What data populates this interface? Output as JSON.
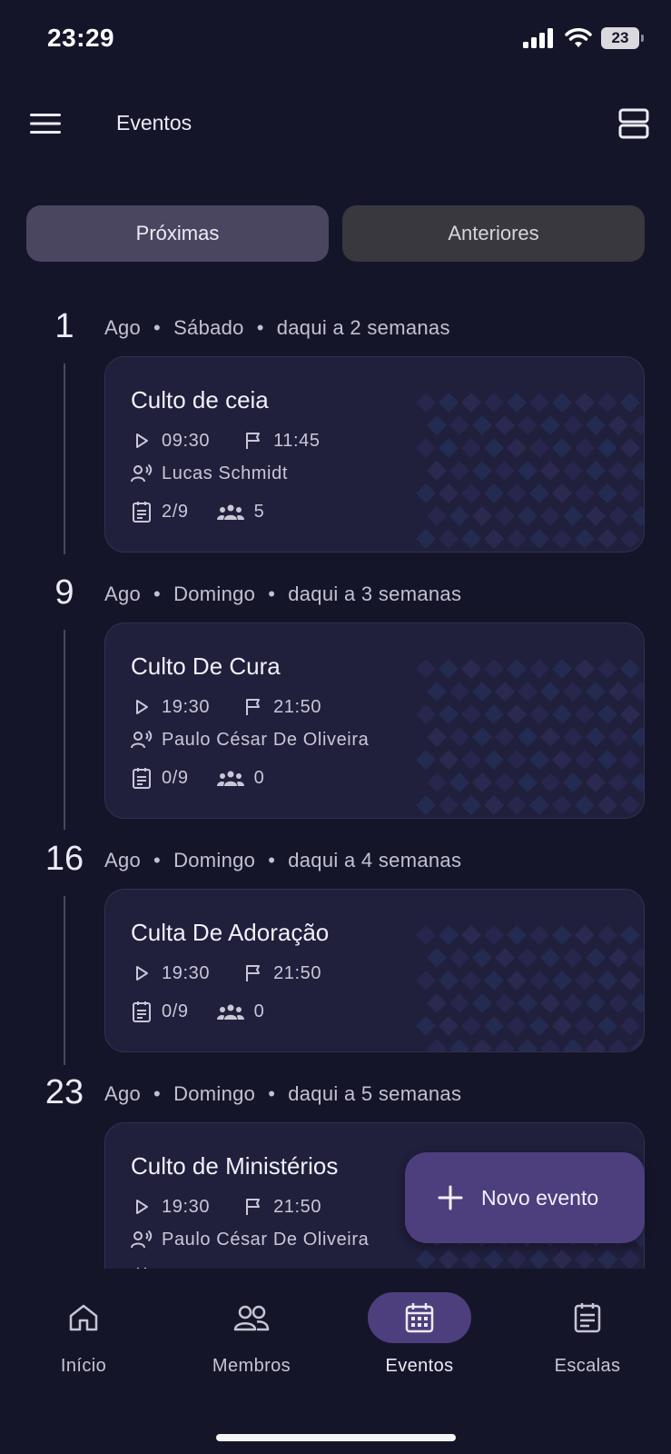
{
  "status": {
    "time": "23:29",
    "battery": "23"
  },
  "app_bar": {
    "title": "Eventos"
  },
  "tabs": [
    {
      "label": "Próximas",
      "active": true
    },
    {
      "label": "Anteriores",
      "active": false
    }
  ],
  "events": [
    {
      "day": "1",
      "month": "Ago",
      "weekday": "Sábado",
      "relative": "daqui a 2 semanas",
      "title": "Culto de ceia",
      "start": "09:30",
      "end": "11:45",
      "leader": "Lucas Schmidt",
      "scales": "2/9",
      "members": "5"
    },
    {
      "day": "9",
      "month": "Ago",
      "weekday": "Domingo",
      "relative": "daqui a 3 semanas",
      "title": "Culto De Cura",
      "start": "19:30",
      "end": "21:50",
      "leader": "Paulo César De Oliveira",
      "scales": "0/9",
      "members": "0"
    },
    {
      "day": "16",
      "month": "Ago",
      "weekday": "Domingo",
      "relative": "daqui a 4 semanas",
      "title": "Culta De Adoração",
      "start": "19:30",
      "end": "21:50",
      "scales": "0/9",
      "members": "0"
    },
    {
      "day": "23",
      "month": "Ago",
      "weekday": "Domingo",
      "relative": "daqui a 5 semanas",
      "title": "Culto de Ministérios",
      "start": "19:30",
      "end": "21:50",
      "leader": "Paulo César De Oliveira"
    }
  ],
  "fab": {
    "label": "Novo evento",
    "icon": "plus-icon"
  },
  "bottom_nav": [
    {
      "label": "Início",
      "icon": "home-icon",
      "active": false
    },
    {
      "label": "Membros",
      "icon": "members-icon",
      "active": false
    },
    {
      "label": "Eventos",
      "icon": "calendar-icon",
      "active": true
    },
    {
      "label": "Escalas",
      "icon": "schedule-icon",
      "active": false
    }
  ],
  "colors": {
    "background": "#15152a",
    "card": "#201f3c",
    "accent": "#4d3f7e",
    "tab_active": "#4a4660",
    "tab_inactive": "#39383e"
  }
}
